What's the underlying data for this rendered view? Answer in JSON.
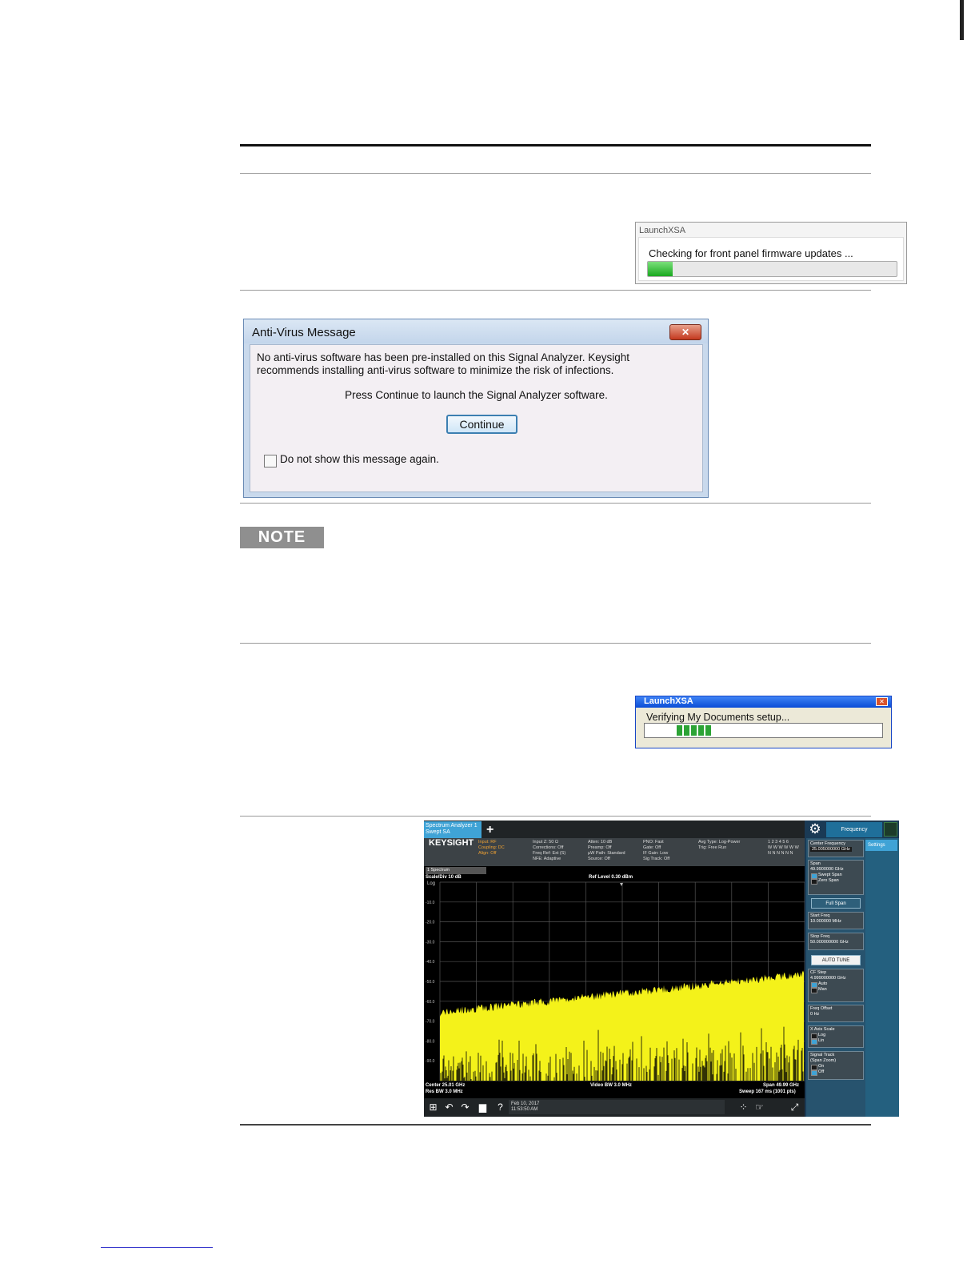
{
  "launch1": {
    "title": "LaunchXSA",
    "message": "Checking for front panel firmware updates ...",
    "progress": 0.1
  },
  "antivirus": {
    "title": "Anti-Virus Message",
    "close_label": "✕",
    "line1": "No anti-virus software has been pre-installed on this Signal Analyzer.  Keysight",
    "line2": "recommends installing anti-virus software to minimize the risk of infections.",
    "prompt": "Press Continue to launch the Signal Analyzer software.",
    "continue_label": "Continue",
    "checkbox_label": "Do not show this message again."
  },
  "note": {
    "label": "NOTE"
  },
  "launch2": {
    "title": "LaunchXSA",
    "close_label": "✕",
    "message": "Verifying My Documents setup..."
  },
  "analyzer": {
    "tab_label": "Spectrum Analyzer 1\nSwept SA",
    "plus": "+",
    "gear": "⚙",
    "freq_tab": "Frequency",
    "logo": "KEYSIGHT",
    "meas1": "Input: RF\nCoupling: DC\nAlign: Off",
    "meas2": "Input Z: 50 Ω\nCorrections: Off\nFreq Ref: Ext (S)\nNFE: Adaptive",
    "meas3": "Atten: 10 dB\nPreamp: Off\nµW Path: Standard\nSource: Off",
    "meas4": "PNO: Fast\nGate: Off\nIF Gain: Low\nSig Track: Off",
    "meas5": "Avg Type: Log-Power\nTrig: Free Run",
    "trace_nums": "1 2 3 4 5 6\nW W W W W W\nN N N N N N",
    "spectrum_select": "1 Spectrum",
    "scale_div": "Scale/Div 10 dB",
    "log": "Log",
    "ref_level": "Ref Level 0.30 dBm",
    "y_ticks": [
      "-10.0",
      "-20.0",
      "-30.0",
      "-40.0",
      "-50.0",
      "-60.0",
      "-70.0",
      "-80.0",
      "-90.0"
    ],
    "center": "Center 25.01 GHz",
    "res_bw": "Res BW 3.0 MHz",
    "video_bw": "Video BW 3.0 MHz",
    "span": "Span 49.99 GHz",
    "sweep": "Sweep 167 ms (1001 pts)",
    "date": "Feb 10, 2017\n11:53:50 AM",
    "settings": "Settings",
    "panel": {
      "center_freq_label": "Center Frequency",
      "center_freq_value": "25.005000000 GHz",
      "span_label": "Span",
      "span_value": "49.9900000 GHz",
      "swept_span": "Swept Span",
      "zero_span": "Zero Span",
      "full_span": "Full Span",
      "start_label": "Start Freq",
      "start_value": "10.000000 MHz",
      "stop_label": "Stop Freq",
      "stop_value": "50.000000000 GHz",
      "auto_tune": "AUTO TUNE",
      "cf_step_label": "CF Step",
      "cf_step_value": "4.999000000 GHz",
      "auto": "Auto",
      "man": "Man",
      "offset_label": "Freq Offset",
      "offset_value": "0 Hz",
      "xaxis_label": "X Axis Scale",
      "log": "Log",
      "lin": "Lin",
      "sigtrack_label": "Signal Track",
      "sigtrack_sub": "(Span Zoom)",
      "on": "On",
      "off": "Off"
    },
    "colors": {
      "trace": "#f4f21a",
      "background": "#000000",
      "accent": "#3fa3d6"
    }
  }
}
